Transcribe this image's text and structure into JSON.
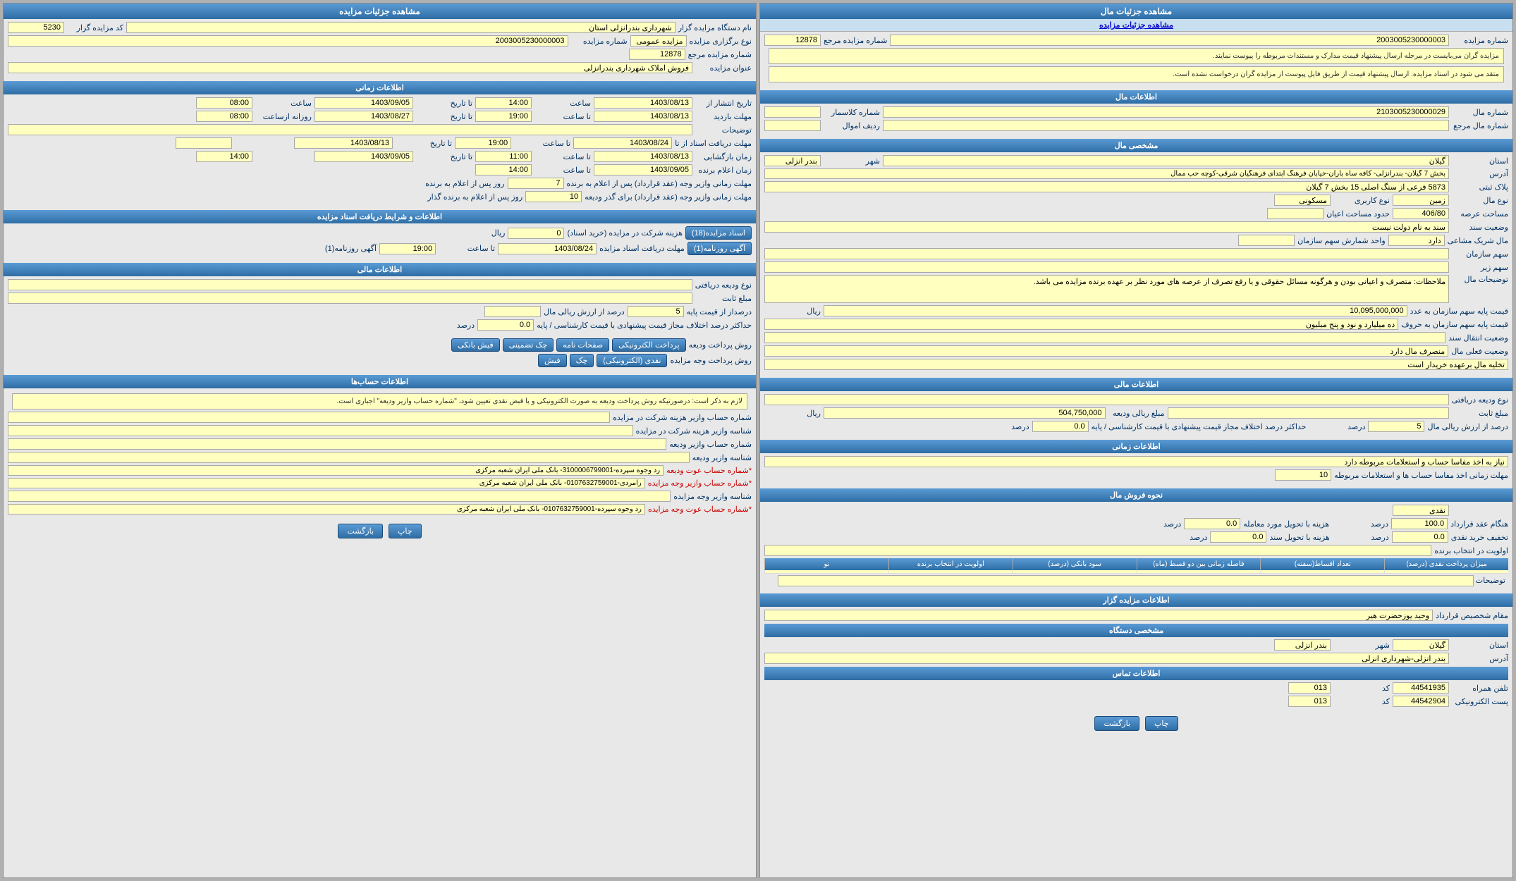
{
  "left_panel": {
    "title": "مشاهده جزئیات مال",
    "sub_link": "مشاهده جزئیات مزایده",
    "notice1": "مزایده گران می‌بایست در مرحله ارسال پیشنهاد قیمت مدارک و مستندات مربوطه را پیوست نمایند.",
    "notice2": "متقد می شود در اسناد مزایده. ارسال پیشنهاد قیمت از طریق فایل پیوست از مزایده گران درخواست نشده است.",
    "auction_no": "2003005230000003",
    "auction_ref_no": "12878",
    "sections": {
      "asset_info": {
        "title": "اطلاعات مال",
        "mal_no": "2103005230000029",
        "mal_ref_no": "",
        "class_no": "",
        "asset_redif": "",
        "province": "گیلان",
        "city": "بندر انزلی",
        "address": "بخش 7 گیلان- بندرانزلی- کافه ساه باران-خیابان فرهنگ ابتدای فرهنگیان شرقی-کوچه حب ممال",
        "block_no": "5873 فرعی از سنگ اصلی 15 بخش 7 گیلان",
        "asset_type": "زمین",
        "usage_type": "مسکونی",
        "area": "406/80",
        "shared_area": "",
        "ownership": "سند به نام دولت نیست",
        "partner": "ندارد",
        "shares_org": "",
        "shares_sub": "",
        "notes": "ملاحظات: متصرف و اعیانی بودن و هرگونه مسائل حقوقی و یا رفع تصرف از عرصه های مورد نظر بر عهده برنده مزایده می باشد.",
        "base_price": "10,095,000,000",
        "base_price_shares": "",
        "transfer_status": "",
        "asset_status": "منصرف مال دارد",
        "buyer_status": "تخلیه مال برعهده خریدار است"
      },
      "financial_info": {
        "title": "اطلاعات مالی",
        "deposit_type": "",
        "fixed_amount": "",
        "percent_of_base": "5",
        "max_diff_percent": "0.0",
        "deposit_amount": "504,750,000"
      },
      "time_info": {
        "title": "اطلاعات زمانی",
        "note": "نیاز به اخذ مفاسا حساب و استعلامات مربوطه دارد",
        "duration": "10"
      },
      "sale_method": {
        "title": "نحوه فروش مال",
        "type": "نقدی",
        "contract_time_percent": "100.0",
        "commission": "0.0",
        "discount": "0.0",
        "to_installment": "0.0",
        "priority": "",
        "columns": [
          "میزان پرداخت نقدی (درصد)",
          "تعداد اقساط(سفته)",
          "فاصله زمانی بین دو قسط (ماه)",
          "سود بانکی (درصد)",
          "اولویت در انتخاب برنده",
          "نو"
        ],
        "rows": []
      },
      "organizer_info": {
        "title": "اطلاعات مزایده گزار",
        "contract_person": "مقام شخصیص قرارداد وحید یوزحضرت هیر",
        "province": "گیلان",
        "city": "بندر انزلی",
        "address": "بندر انزلی-شهرداری انزلی",
        "phone_fixed": "44541935",
        "phone_code": "013",
        "fax": "44542904",
        "fax_code": "013",
        "email": ""
      }
    },
    "buttons": {
      "print": "چاپ",
      "back": "بازگشت"
    }
  },
  "right_panel": {
    "title": "مشاهده جزئیات مزایده",
    "fields": {
      "auction_organizer": "شهرداری بندرانزلی استان",
      "auction_code": "5230",
      "auction_no": "2003005230000003",
      "auction_ref_no": "12878",
      "auction_type": "مزایده عمومی",
      "auction_title": "فروش املاک شهرداری بندرانزلی"
    },
    "time_info": {
      "title": "اطلاعات زمانی",
      "start_date": "1403/08/13",
      "start_time": "14:00",
      "end_date": "1403/09/05",
      "end_time": "08:00",
      "bid_deadline_date": "1403/08/13",
      "bid_deadline_time": "19:00",
      "visit_date": "1403/08/27",
      "visit_time": "08:00",
      "notes": "",
      "doc_deadline_date": "1403/08/24",
      "doc_deadline_time_from": "19:00",
      "doc_deadline_to_date": "1403/08/13",
      "doc_deadline_to_time": "",
      "doc_submit_date": "1403/08/13",
      "doc_submit_from_time": "11:00",
      "doc_submit_to_date": "1403/09/05",
      "doc_submit_to_time": "14:00",
      "announce_date": "1403/09/05",
      "announce_time": "14:00",
      "contract_sign_days": "7",
      "deposit_return_days": "10"
    },
    "bond_info": {
      "title": "اطلاعات و شرایط دریافت اسناد مزایده",
      "price": "0",
      "doc_btn": "اسناد مزایده(18)",
      "bond_btn": "آگهی روزنامه(1)",
      "deadline_date": "1403/08/24",
      "deadline_time": "19:00",
      "note": "هزینه شرکت در مزایده (خرید اسناد)"
    },
    "financial_info": {
      "title": "اطلاعات مالی",
      "deposit_type": "",
      "fixed_amount": "",
      "percent_of_base": "5",
      "max_diff": "0.0",
      "rial_from_value": ""
    },
    "payment_methods": {
      "deposit_method_label": "روش پرداخت ودیعه",
      "methods": [
        "پرداخت الکترونیکی",
        "صفحات نامه",
        "چک تضمینی",
        "فیش بانکی"
      ],
      "voje_method_label": "روش پرداخت وجه مزایده",
      "voje_methods": [
        "نقدی (الکترونیکی)",
        "چک",
        "فیش"
      ]
    },
    "accounts": {
      "title": "اطلاعات حساب‌ها",
      "notice": "لازم به ذکر است: درصورتیکه روش پرداخت ودیعه به صورت الکترونیکی و یا قبض نقدی تعیین شود، \"شماره حساب وازیر ودیعه\" اجباری است.",
      "fields": [
        {
          "label": "شماره حساب وازیر هزینه شرکت در مزایده",
          "value": ""
        },
        {
          "label": "شناسه وازیر هزینه شرکت در مزایده",
          "value": ""
        },
        {
          "label": "شماره حساب وازیر ودیعه",
          "value": ""
        },
        {
          "label": "شناسه وازیر ودیعه",
          "value": ""
        },
        {
          "label": "شماره حساب عوت ودیعه",
          "value": "شماره حساب عوت ودیعه- رد وجوه سپرده-3100006799001- بانک ملی ایران شعبه مرکزی"
        },
        {
          "label": "شماره حساب وازیر وجه مزایده",
          "value": "شماره حساب وازیر وجه مزایده- رامردی-0107632759001- بانک ملی ایران شعبه مرکزی"
        },
        {
          "label": "شناسه وازیر وجه مزایده",
          "value": ""
        },
        {
          "label": "شماره حساب عوت وجه مزایده",
          "value": "شماره حساب عوت وجه مزایده- رد وجوه سپرده-0107632759001- بانک ملی ایران شعبه مرکزی"
        }
      ]
    },
    "buttons": {
      "print": "چاپ",
      "back": "بازگشت"
    }
  }
}
